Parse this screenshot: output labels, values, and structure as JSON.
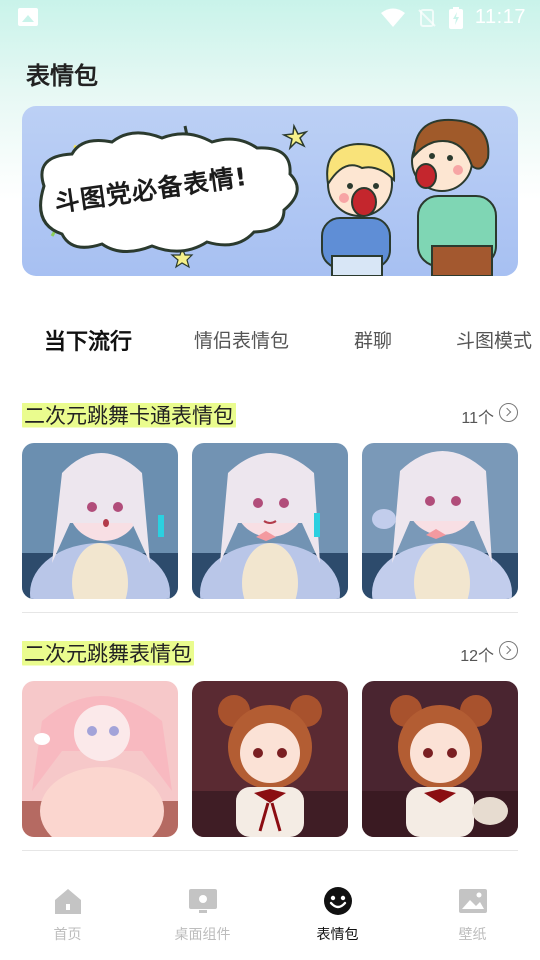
{
  "status_bar": {
    "time": "11:17"
  },
  "page_title": "表情包",
  "banner": {
    "text": "斗图党必备表情!"
  },
  "tabs": [
    {
      "label": "当下流行",
      "active": true
    },
    {
      "label": "情侣表情包",
      "active": false
    },
    {
      "label": "群聊",
      "active": false
    },
    {
      "label": "斗图模式",
      "active": false
    }
  ],
  "sections": [
    {
      "title": "二次元跳舞卡通表情包",
      "count": "11个"
    },
    {
      "title": "二次元跳舞表情包",
      "count": "12个"
    }
  ],
  "bottom_nav": [
    {
      "label": "首页",
      "icon": "home-icon",
      "active": false
    },
    {
      "label": "桌面组件",
      "icon": "widget-icon",
      "active": false
    },
    {
      "label": "表情包",
      "icon": "smiley-icon",
      "active": true
    },
    {
      "label": "壁纸",
      "icon": "image-icon",
      "active": false
    }
  ],
  "colors": {
    "title_highlight": "#eafc8e",
    "active_nav": "#111111",
    "inactive_nav": "#bdbdbd"
  }
}
